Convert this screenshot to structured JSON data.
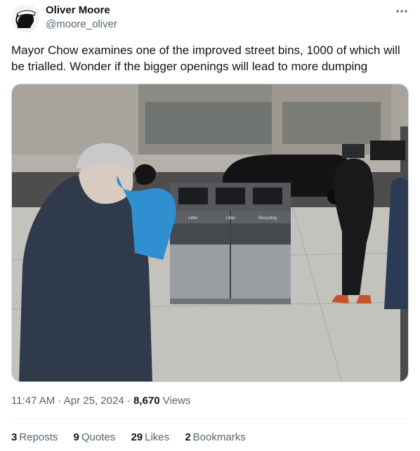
{
  "author": {
    "name": "Oliver Moore",
    "handle": "@moore_oliver",
    "avatar_icon": "moor-head-avatar"
  },
  "more_icon": "more-options-icon",
  "tweet_text": "Mayor Chow examines one of the improved street bins, 1000 of which will be trialled. Wonder if the bigger openings will lead to more dumping",
  "media": {
    "bin_labels": [
      "Litter",
      "Litter",
      "Recycling"
    ]
  },
  "meta": {
    "time": "11:47 AM",
    "separator": "·",
    "date": "Apr 25, 2024",
    "views_count": "8,670",
    "views_label": "Views"
  },
  "stats": [
    {
      "count": "3",
      "label": "Reposts"
    },
    {
      "count": "9",
      "label": "Quotes"
    },
    {
      "count": "29",
      "label": "Likes"
    },
    {
      "count": "2",
      "label": "Bookmarks"
    }
  ],
  "colors": {
    "text": "#0f1419",
    "secondary": "#536471",
    "divider": "#eff3f4"
  }
}
